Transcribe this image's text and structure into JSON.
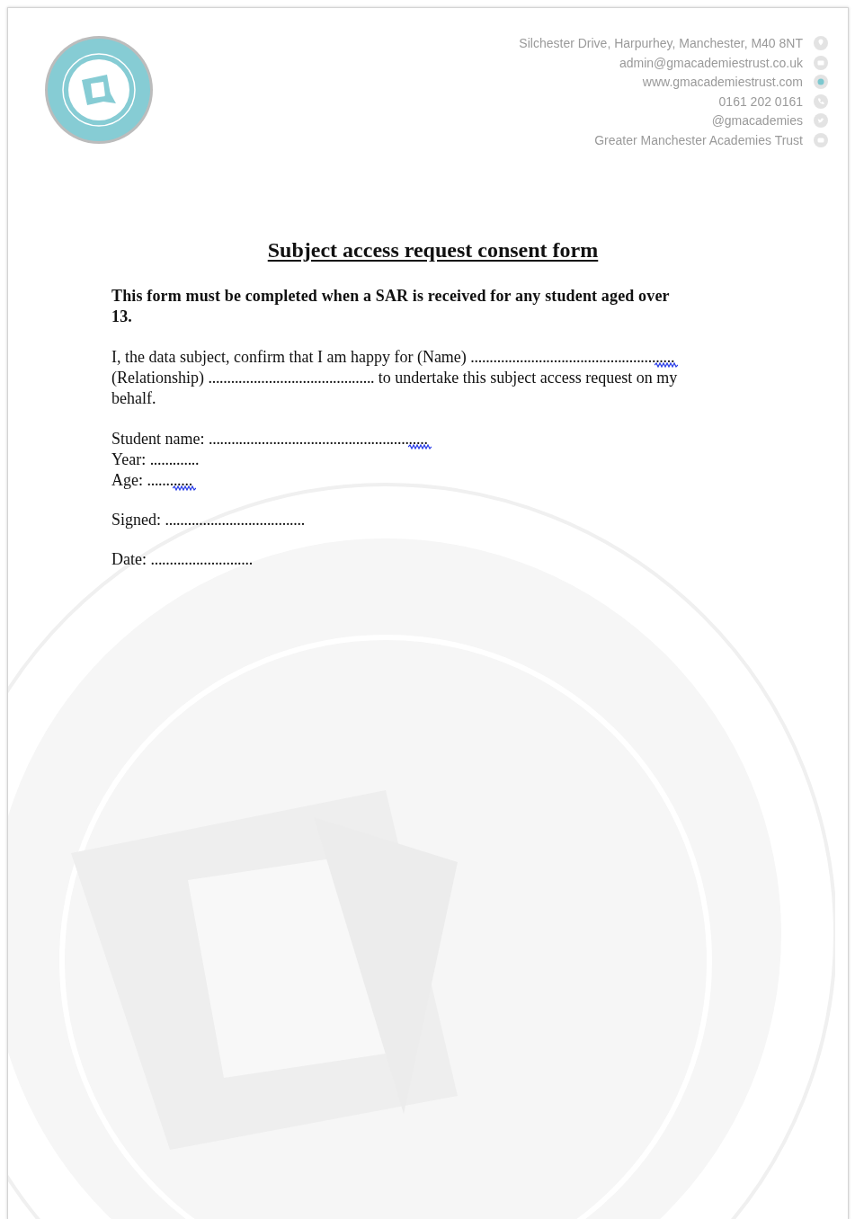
{
  "letterhead": {
    "contacts": [
      {
        "kind": "address",
        "text": "Silchester Drive, Harpurhey, Manchester, M40 8NT"
      },
      {
        "kind": "email",
        "text": "admin@gmacademiestrust.co.uk"
      },
      {
        "kind": "web",
        "text": "www.gmacademiestrust.com"
      },
      {
        "kind": "phone",
        "text": "0161 202 0161"
      },
      {
        "kind": "social",
        "text": "@gmacademies"
      },
      {
        "kind": "video",
        "text": "Greater Manchester Academies Trust"
      }
    ]
  },
  "title": "Subject access request consent form",
  "intro": "This form must be completed when a SAR is received for any student aged over 13.",
  "consent": [
    {
      "kind": "text",
      "text": "I, the data subject, confirm that I am happy for (Name)"
    },
    {
      "kind": "field",
      "dots": "......................................................",
      "flagged": true
    },
    {
      "kind": "text",
      "text": "(Relationship)"
    },
    {
      "kind": "field",
      "dots": "............................................",
      "flagged": false
    },
    {
      "kind": "text",
      "text": "to undertake this subject access request on my behalf."
    }
  ],
  "field_groups": [
    [
      {
        "label": "Student name:",
        "dots": "..........................................................",
        "flagged": true
      },
      {
        "label": "Year:",
        "dots": ".............",
        "flagged": false
      },
      {
        "label": "Age:",
        "dots": "............",
        "flagged": true
      }
    ],
    [
      {
        "label": "Signed:",
        "dots": ".....................................",
        "flagged": false
      }
    ],
    [
      {
        "label": "Date:",
        "dots": "...........................",
        "flagged": false
      }
    ]
  ]
}
